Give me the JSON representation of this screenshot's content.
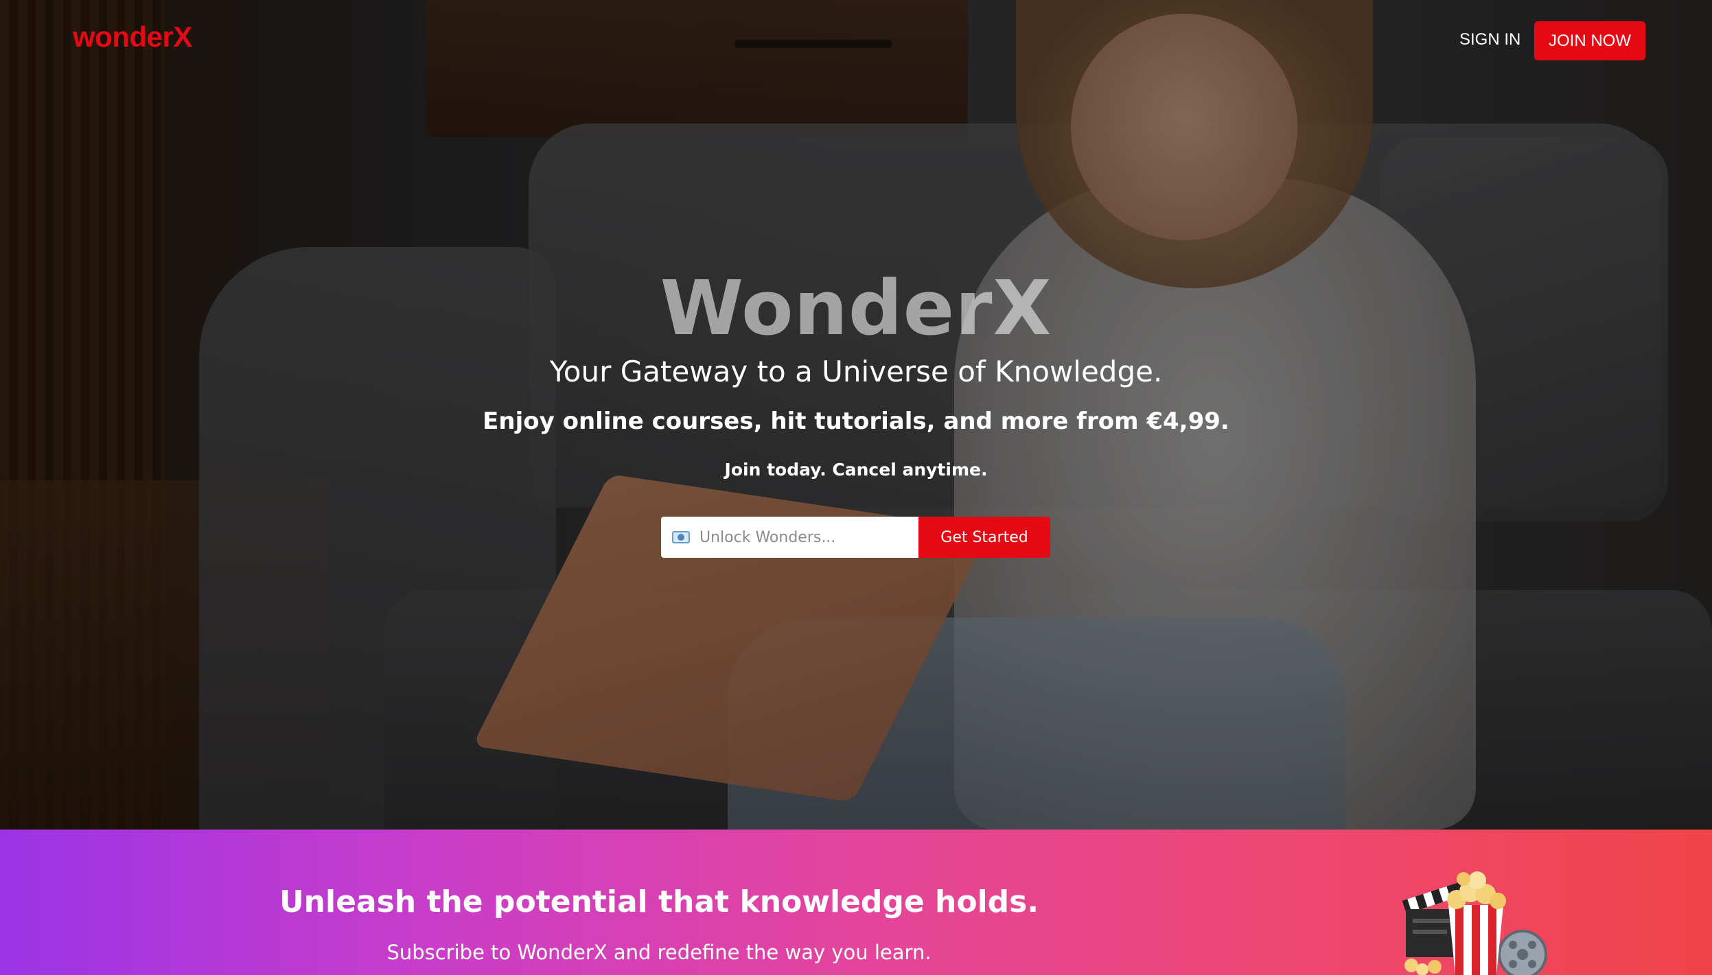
{
  "nav": {
    "logo": "wonderX",
    "sign_in": "SIGN IN",
    "join_now": "JOIN NOW"
  },
  "hero": {
    "title": "WonderX",
    "subtitle": "Your Gateway to a Universe of Knowledge.",
    "offer": "Enjoy online courses, hit tutorials, and more from €4,99.",
    "note": "Join today. Cancel anytime.",
    "signup": {
      "placeholder": "Unlock Wonders...",
      "button": "Get Started"
    }
  },
  "promo": {
    "heading": "Unleash the potential that knowledge holds.",
    "subheading": "Subscribe to WonderX and redefine the way you learn."
  },
  "colors": {
    "brand_red": "#e50914",
    "promo_gradient_start": "#9b34e6",
    "promo_gradient_end": "#f14348"
  },
  "icons": {
    "signup_field_icon": "mail-icon",
    "promo_art": "popcorn-clapperboard-icon"
  }
}
